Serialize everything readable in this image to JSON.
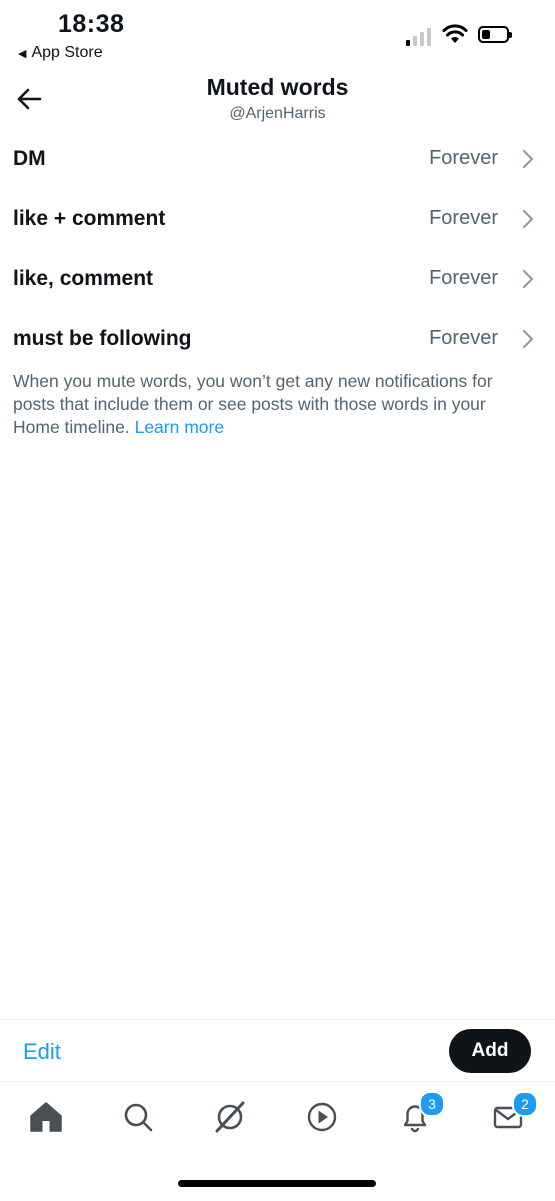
{
  "status_bar": {
    "time": "18:38",
    "back_app": "App Store"
  },
  "header": {
    "title": "Muted words",
    "subtitle": "@ArjenHarris"
  },
  "muted_words": [
    {
      "word": "DM",
      "duration": "Forever"
    },
    {
      "word": "like + comment",
      "duration": "Forever"
    },
    {
      "word": "like, comment",
      "duration": "Forever"
    },
    {
      "word": "must be following",
      "duration": "Forever"
    }
  ],
  "info": {
    "text": "When you mute words, you won’t get any new notifications for posts that include them or see posts with those words in your Home timeline.",
    "link": "Learn more"
  },
  "actions": {
    "edit": "Edit",
    "add": "Add"
  },
  "tab_bar": {
    "tabs": [
      {
        "icon": "home-icon"
      },
      {
        "icon": "search-icon"
      },
      {
        "icon": "communities-icon"
      },
      {
        "icon": "video-icon"
      },
      {
        "icon": "notifications-icon",
        "badge": "3"
      },
      {
        "icon": "messages-icon",
        "badge": "2"
      }
    ]
  },
  "colors": {
    "accent": "#1d9bf0",
    "text": "#0f1419",
    "secondary": "#536471"
  }
}
